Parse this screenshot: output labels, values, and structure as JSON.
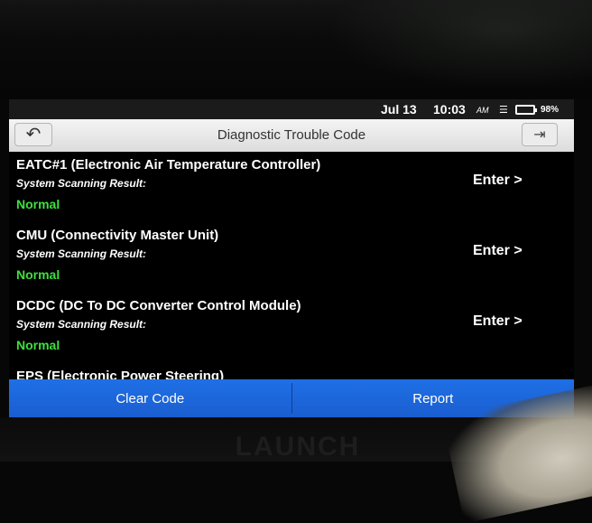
{
  "status_bar": {
    "date": "Jul 13",
    "time": "10:03",
    "signal_icon_text": "AM",
    "wifi_icon": "wifi-icon",
    "battery_percent": "98%",
    "battery_level": 0.98
  },
  "title_bar": {
    "title": "Diagnostic Trouble Code",
    "back_icon": "back-arrow-icon",
    "exit_icon": "exit-icon"
  },
  "modules": [
    {
      "name": "EATC#1 (Electronic Air Temperature Controller)",
      "subtitle": "System Scanning Result:",
      "status": "Normal",
      "action": "Enter >"
    },
    {
      "name": "CMU (Connectivity Master Unit)",
      "subtitle": "System Scanning Result:",
      "status": "Normal",
      "action": "Enter >"
    },
    {
      "name": "DCDC (DC To DC Converter Control Module)",
      "subtitle": "System Scanning Result:",
      "status": "Normal",
      "action": "Enter >"
    },
    {
      "name": "EPS (Electronic Power Steering)"
    }
  ],
  "bottom_bar": {
    "clear_code": "Clear Code",
    "report": "Report"
  },
  "device": {
    "brand": "LAUNCH"
  },
  "colors": {
    "normal_status": "#3ee03e",
    "bottom_bar": "#1f6fe6",
    "title_bar": "#e8e8e8"
  }
}
